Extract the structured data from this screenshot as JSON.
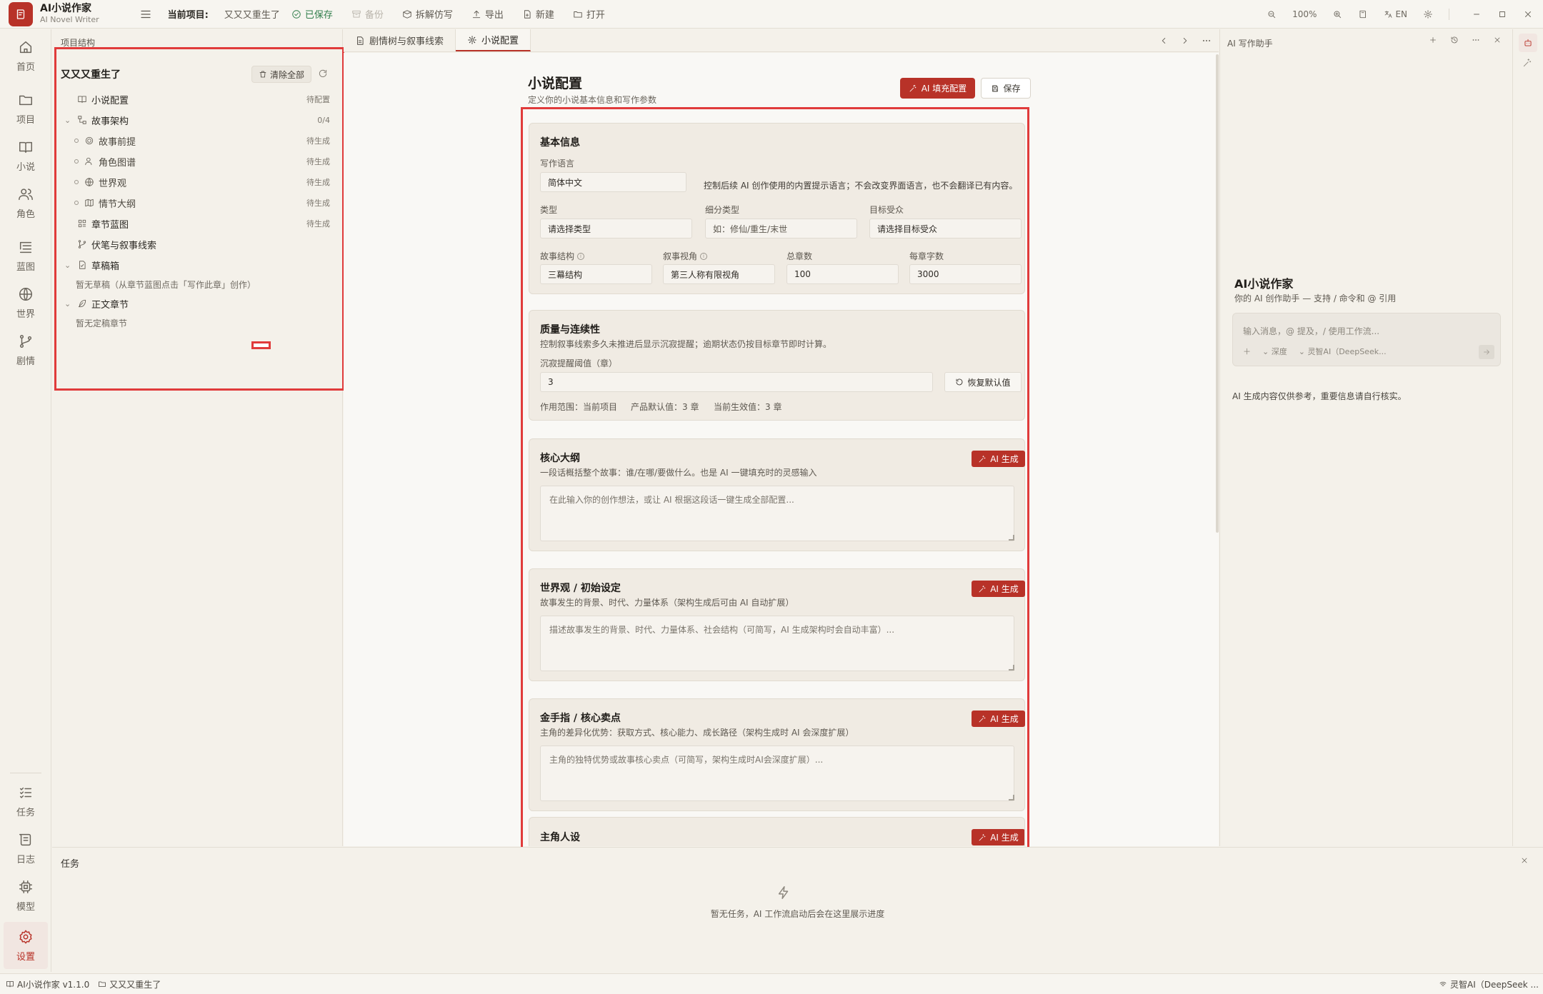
{
  "app": {
    "name": "AI小说作家",
    "subtitle": "AI Novel Writer"
  },
  "toolbar": {
    "current_project_label": "当前项目:",
    "current_project": "又又又重生了",
    "saved": "已保存",
    "backup": "备份",
    "deconstruct": "拆解仿写",
    "export": "导出",
    "new": "新建",
    "open": "打开",
    "zoom": "100%",
    "lang": "EN"
  },
  "rail": {
    "home": "首页",
    "project": "项目",
    "novel": "小说",
    "character": "角色",
    "blueprint": "蓝图",
    "world": "世界",
    "plot": "剧情",
    "tasks": "任务",
    "log": "日志",
    "model": "模型",
    "settings": "设置"
  },
  "tree": {
    "header": "项目结构",
    "project": "又又又重生了",
    "clear_all": "清除全部",
    "nodes": [
      {
        "label": "小说配置",
        "status": "待配置"
      },
      {
        "label": "故事架构",
        "status": "0/4"
      },
      {
        "label": "故事前提",
        "status": "待生成"
      },
      {
        "label": "角色图谱",
        "status": "待生成"
      },
      {
        "label": "世界观",
        "status": "待生成"
      },
      {
        "label": "情节大纲",
        "status": "待生成"
      },
      {
        "label": "章节蓝图",
        "status": "待生成"
      },
      {
        "label": "伏笔与叙事线索",
        "status": ""
      },
      {
        "label": "草稿箱",
        "status": ""
      },
      {
        "label": "正文章节",
        "status": ""
      }
    ],
    "drafts_empty": "暂无草稿（从章节蓝图点击「写作此章」创作）",
    "chapters_empty": "暂无定稿章节"
  },
  "tabs": [
    {
      "label": "剧情树与叙事线索"
    },
    {
      "label": "小说配置"
    }
  ],
  "config": {
    "title": "小说配置",
    "subtitle": "定义你的小说基本信息和写作参数",
    "ai_fill": "AI 填充配置",
    "save": "保存",
    "basic": {
      "title": "基本信息",
      "lang_label": "写作语言",
      "lang_value": "简体中文",
      "lang_hint": "控制后续 AI 创作使用的内置提示语言；不会改变界面语言，也不会翻译已有内容。",
      "genre_label": "类型",
      "genre_value": "请选择类型",
      "subgenre_label": "细分类型",
      "subgenre_placeholder": "如：修仙/重生/末世",
      "audience_label": "目标受众",
      "audience_value": "请选择目标受众",
      "structure_label": "故事结构",
      "structure_value": "三幕结构",
      "pov_label": "叙事视角",
      "pov_value": "第三人称有限视角",
      "chapters_label": "总章数",
      "chapters_value": "100",
      "words_label": "每章字数",
      "words_value": "3000"
    },
    "quality": {
      "title": "质量与连续性",
      "subtitle": "控制叙事线索多久未推进后显示沉寂提醒；逾期状态仍按目标章节即时计算。",
      "threshold_label": "沉寂提醒阈值（章）",
      "threshold_value": "3",
      "reset": "恢复默认值",
      "scope": "作用范围：当前项目",
      "default_value": "产品默认值：3 章",
      "effective_value": "当前生效值：3 章"
    },
    "outline": {
      "title": "核心大纲",
      "subtitle": "一段话概括整个故事：谁/在哪/要做什么。也是 AI 一键填充时的灵感输入",
      "placeholder": "在此输入你的创作想法，或让 AI 根据这段话一键生成全部配置...",
      "ai": "AI 生成"
    },
    "world": {
      "title": "世界观 / 初始设定",
      "subtitle": "故事发生的背景、时代、力量体系（架构生成后可由 AI 自动扩展）",
      "placeholder": "描述故事发生的背景、时代、力量体系、社会结构（可简写，AI 生成架构时会自动丰富）...",
      "ai": "AI 生成"
    },
    "cheat": {
      "title": "金手指 / 核心卖点",
      "subtitle": "主角的差异化优势：获取方式、核心能力、成长路径（架构生成时 AI 会深度扩展）",
      "placeholder": "主角的独特优势或故事核心卖点（可简写，架构生成时AI会深度扩展）...",
      "ai": "AI 生成"
    },
    "protagonist": {
      "title": "主角人设",
      "ai": "AI 生成"
    }
  },
  "assistant": {
    "header": "AI 写作助手",
    "title": "AI小说作家",
    "subtitle": "你的 AI 创作助手 — 支持 / 命令和 @ 引用",
    "placeholder": "输入消息，@ 提及，/ 使用工作流...",
    "depth": "深度",
    "model": "灵智AI（DeepSeek...",
    "note": "AI 生成内容仅供参考，重要信息请自行核实。"
  },
  "tasks": {
    "title": "任务",
    "empty": "暂无任务，AI 工作流启动后会在这里展示进度"
  },
  "statusbar": {
    "app": "AI小说作家 v1.1.0",
    "project": "又又又重生了",
    "model": "灵智AI（DeepSeek ..."
  }
}
